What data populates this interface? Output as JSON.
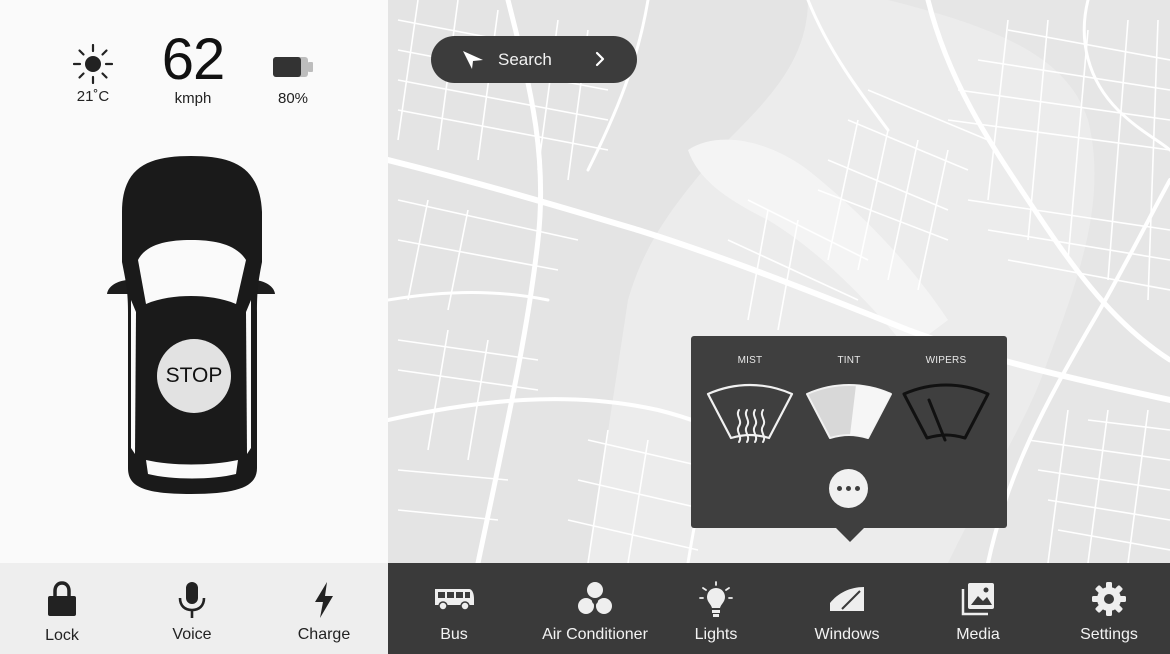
{
  "status": {
    "temperature": "21˚C",
    "speed_value": "62",
    "speed_unit": "kmph",
    "battery_percent": "80%",
    "battery_level": 0.8
  },
  "car": {
    "stop_label": "STOP"
  },
  "search": {
    "label": "Search"
  },
  "window_popup": {
    "options": [
      {
        "label": "MIST",
        "icon": "windshield-defrost-icon"
      },
      {
        "label": "TINT",
        "icon": "window-tint-icon"
      },
      {
        "label": "WIPERS",
        "icon": "wiper-icon"
      }
    ],
    "more_icon": "more-dots-icon"
  },
  "bottom_nav_left": [
    {
      "label": "Lock",
      "icon": "lock-icon"
    },
    {
      "label": "Voice",
      "icon": "microphone-icon"
    },
    {
      "label": "Charge",
      "icon": "lightning-icon"
    }
  ],
  "bottom_nav_right": [
    {
      "label": "Bus",
      "icon": "bus-icon"
    },
    {
      "label": "Air Conditioner",
      "icon": "fan-icon"
    },
    {
      "label": "Lights",
      "icon": "lightbulb-icon"
    },
    {
      "label": "Windows",
      "icon": "window-icon"
    },
    {
      "label": "Media",
      "icon": "photos-icon"
    },
    {
      "label": "Settings",
      "icon": "gear-icon"
    }
  ],
  "colors": {
    "dark_panel": "#3a3a3a",
    "light_panel": "#fafafa",
    "map_bg": "#ececec",
    "map_roads": "#ffffff"
  }
}
